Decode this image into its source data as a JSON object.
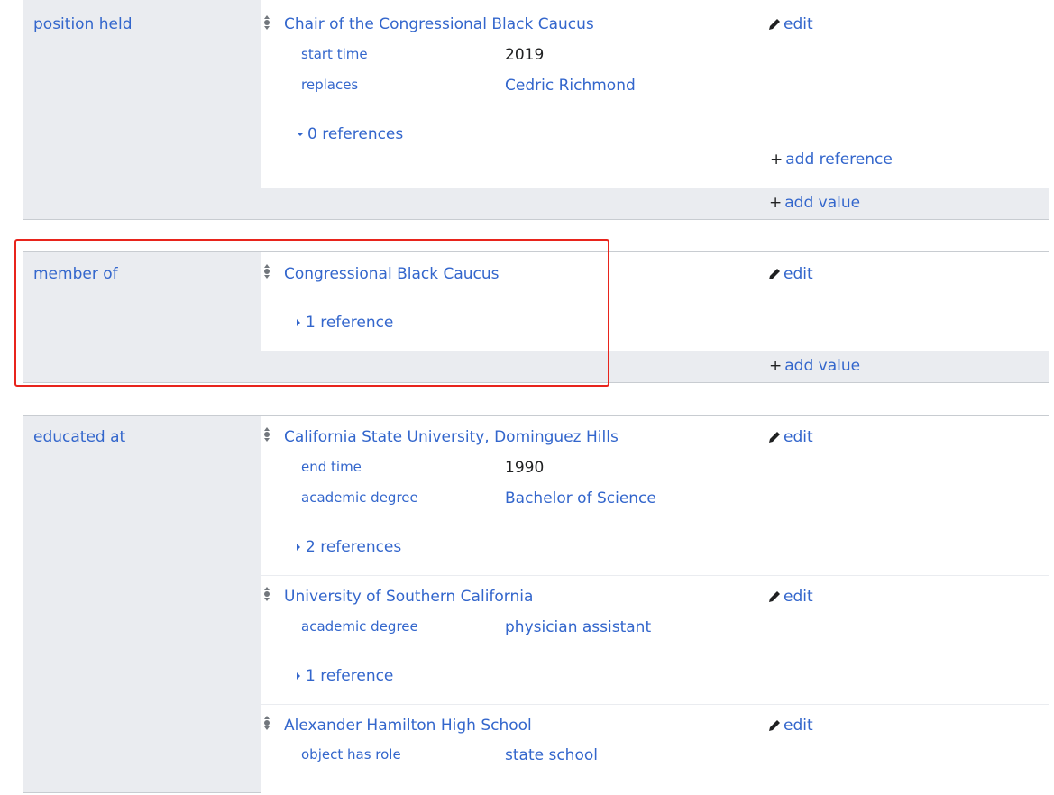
{
  "colors": {
    "link": "#3366cc",
    "group_bg": "#eaecf0",
    "border": "#c8ccd1",
    "highlight": "#e8241c"
  },
  "icons": {
    "rank": "rank-normal-icon",
    "edit": "pencil-icon"
  },
  "groups": [
    {
      "property": "position held",
      "statements": [
        {
          "value": "Chair of the Congressional Black Caucus",
          "edit_label": "edit",
          "qualifiers": [
            {
              "property": "start time",
              "value": "2019"
            },
            {
              "property": "replaces",
              "value": "Cedric Richmond"
            }
          ],
          "references_label": "0 references",
          "references_expanded": true,
          "add_reference_label": "add reference"
        }
      ],
      "add_value_label": "add value"
    },
    {
      "property": "member of",
      "statements": [
        {
          "value": "Congressional Black Caucus",
          "edit_label": "edit",
          "qualifiers": [],
          "references_label": "1 reference"
        }
      ],
      "add_value_label": "add value"
    },
    {
      "property": "educated at",
      "statements": [
        {
          "value": "California State University, Dominguez Hills",
          "edit_label": "edit",
          "qualifiers": [
            {
              "property": "end time",
              "value": "1990"
            },
            {
              "property": "academic degree",
              "value": "Bachelor of Science"
            }
          ],
          "references_label": "2 references"
        },
        {
          "value": "University of Southern California",
          "edit_label": "edit",
          "qualifiers": [
            {
              "property": "academic degree",
              "value": "physician assistant"
            }
          ],
          "references_label": "1 reference"
        },
        {
          "value": "Alexander Hamilton High School",
          "edit_label": "edit",
          "qualifiers": [
            {
              "property": "object has role",
              "value": "state school"
            }
          ]
        }
      ]
    }
  ]
}
